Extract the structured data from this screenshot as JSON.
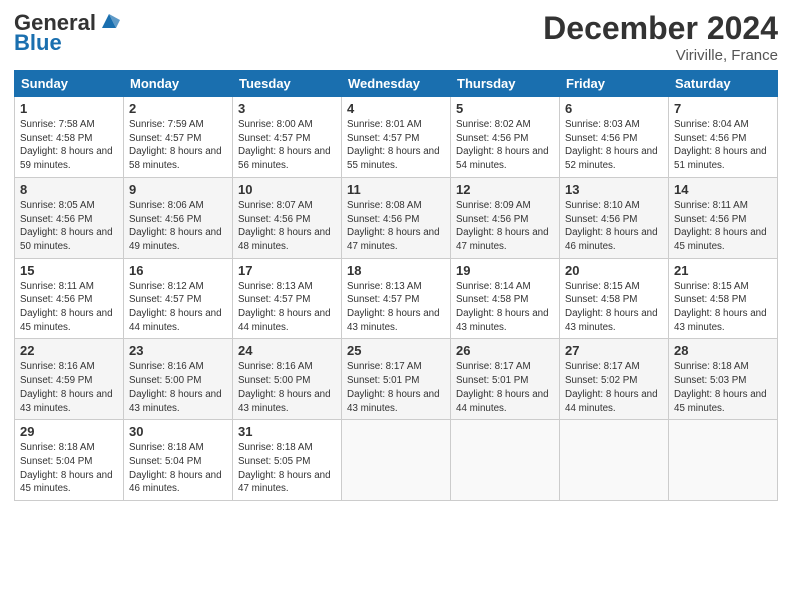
{
  "header": {
    "logo_general": "General",
    "logo_blue": "Blue",
    "month_title": "December 2024",
    "location": "Viriville, France"
  },
  "days_of_week": [
    "Sunday",
    "Monday",
    "Tuesday",
    "Wednesday",
    "Thursday",
    "Friday",
    "Saturday"
  ],
  "weeks": [
    [
      {
        "day": "1",
        "sunrise": "7:58 AM",
        "sunset": "4:58 PM",
        "daylight": "8 hours and 59 minutes."
      },
      {
        "day": "2",
        "sunrise": "7:59 AM",
        "sunset": "4:57 PM",
        "daylight": "8 hours and 58 minutes."
      },
      {
        "day": "3",
        "sunrise": "8:00 AM",
        "sunset": "4:57 PM",
        "daylight": "8 hours and 56 minutes."
      },
      {
        "day": "4",
        "sunrise": "8:01 AM",
        "sunset": "4:57 PM",
        "daylight": "8 hours and 55 minutes."
      },
      {
        "day": "5",
        "sunrise": "8:02 AM",
        "sunset": "4:56 PM",
        "daylight": "8 hours and 54 minutes."
      },
      {
        "day": "6",
        "sunrise": "8:03 AM",
        "sunset": "4:56 PM",
        "daylight": "8 hours and 52 minutes."
      },
      {
        "day": "7",
        "sunrise": "8:04 AM",
        "sunset": "4:56 PM",
        "daylight": "8 hours and 51 minutes."
      }
    ],
    [
      {
        "day": "8",
        "sunrise": "8:05 AM",
        "sunset": "4:56 PM",
        "daylight": "8 hours and 50 minutes."
      },
      {
        "day": "9",
        "sunrise": "8:06 AM",
        "sunset": "4:56 PM",
        "daylight": "8 hours and 49 minutes."
      },
      {
        "day": "10",
        "sunrise": "8:07 AM",
        "sunset": "4:56 PM",
        "daylight": "8 hours and 48 minutes."
      },
      {
        "day": "11",
        "sunrise": "8:08 AM",
        "sunset": "4:56 PM",
        "daylight": "8 hours and 47 minutes."
      },
      {
        "day": "12",
        "sunrise": "8:09 AM",
        "sunset": "4:56 PM",
        "daylight": "8 hours and 47 minutes."
      },
      {
        "day": "13",
        "sunrise": "8:10 AM",
        "sunset": "4:56 PM",
        "daylight": "8 hours and 46 minutes."
      },
      {
        "day": "14",
        "sunrise": "8:11 AM",
        "sunset": "4:56 PM",
        "daylight": "8 hours and 45 minutes."
      }
    ],
    [
      {
        "day": "15",
        "sunrise": "8:11 AM",
        "sunset": "4:56 PM",
        "daylight": "8 hours and 45 minutes."
      },
      {
        "day": "16",
        "sunrise": "8:12 AM",
        "sunset": "4:57 PM",
        "daylight": "8 hours and 44 minutes."
      },
      {
        "day": "17",
        "sunrise": "8:13 AM",
        "sunset": "4:57 PM",
        "daylight": "8 hours and 44 minutes."
      },
      {
        "day": "18",
        "sunrise": "8:13 AM",
        "sunset": "4:57 PM",
        "daylight": "8 hours and 43 minutes."
      },
      {
        "day": "19",
        "sunrise": "8:14 AM",
        "sunset": "4:58 PM",
        "daylight": "8 hours and 43 minutes."
      },
      {
        "day": "20",
        "sunrise": "8:15 AM",
        "sunset": "4:58 PM",
        "daylight": "8 hours and 43 minutes."
      },
      {
        "day": "21",
        "sunrise": "8:15 AM",
        "sunset": "4:58 PM",
        "daylight": "8 hours and 43 minutes."
      }
    ],
    [
      {
        "day": "22",
        "sunrise": "8:16 AM",
        "sunset": "4:59 PM",
        "daylight": "8 hours and 43 minutes."
      },
      {
        "day": "23",
        "sunrise": "8:16 AM",
        "sunset": "5:00 PM",
        "daylight": "8 hours and 43 minutes."
      },
      {
        "day": "24",
        "sunrise": "8:16 AM",
        "sunset": "5:00 PM",
        "daylight": "8 hours and 43 minutes."
      },
      {
        "day": "25",
        "sunrise": "8:17 AM",
        "sunset": "5:01 PM",
        "daylight": "8 hours and 43 minutes."
      },
      {
        "day": "26",
        "sunrise": "8:17 AM",
        "sunset": "5:01 PM",
        "daylight": "8 hours and 44 minutes."
      },
      {
        "day": "27",
        "sunrise": "8:17 AM",
        "sunset": "5:02 PM",
        "daylight": "8 hours and 44 minutes."
      },
      {
        "day": "28",
        "sunrise": "8:18 AM",
        "sunset": "5:03 PM",
        "daylight": "8 hours and 45 minutes."
      }
    ],
    [
      {
        "day": "29",
        "sunrise": "8:18 AM",
        "sunset": "5:04 PM",
        "daylight": "8 hours and 45 minutes."
      },
      {
        "day": "30",
        "sunrise": "8:18 AM",
        "sunset": "5:04 PM",
        "daylight": "8 hours and 46 minutes."
      },
      {
        "day": "31",
        "sunrise": "8:18 AM",
        "sunset": "5:05 PM",
        "daylight": "8 hours and 47 minutes."
      },
      null,
      null,
      null,
      null
    ]
  ]
}
